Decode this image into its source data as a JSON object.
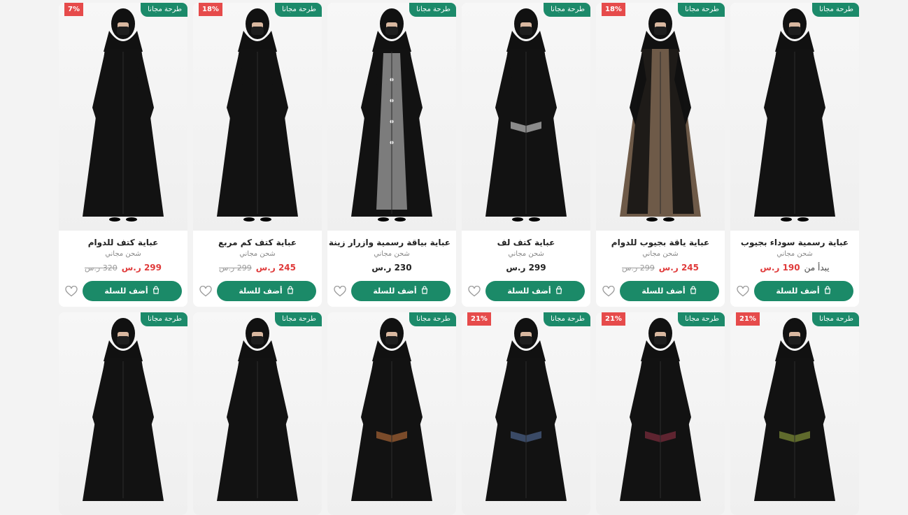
{
  "labels": {
    "free_badge": "طرحة مجانا",
    "shipping": "شحن مجاني",
    "add_to_cart": "أضف للسلة",
    "currency": "ر.س",
    "starts_from": "يبدأ من"
  },
  "colors": {
    "primary_green": "#1b8a68",
    "discount_red": "#e64b4b",
    "price_red": "#e03b3b"
  },
  "products": [
    {
      "title": "عباية رسمية سوداء بجيوب",
      "discount": "",
      "price": "190 ر.س",
      "old_price": "",
      "starts_from": true,
      "dress": "black",
      "trim": "none"
    },
    {
      "title": "عباية ياقة بجيوب للدوام",
      "discount": "18%",
      "price": "245 ر.س",
      "old_price": "299 ر.س",
      "starts_from": false,
      "dress": "brown",
      "trim": "none"
    },
    {
      "title": "عباية كتف لف",
      "discount": "",
      "price": "299 ر.س",
      "old_price": "",
      "starts_from": false,
      "dress": "black",
      "trim": "gray"
    },
    {
      "title": "عباية بياقة رسمية وازرار زينة",
      "discount": "",
      "price": "230 ر.س",
      "old_price": "",
      "starts_from": false,
      "dress": "gray",
      "trim": "none"
    },
    {
      "title": "عباية كتف كم مربع",
      "discount": "18%",
      "price": "245 ر.س",
      "old_price": "299 ر.س",
      "starts_from": false,
      "dress": "black",
      "trim": "none"
    },
    {
      "title": "عباية كتف للدوام",
      "discount": "7%",
      "price": "299 ر.س",
      "old_price": "320 ر.س",
      "starts_from": false,
      "dress": "black",
      "trim": "none"
    }
  ],
  "products_row2": [
    {
      "discount": "21%",
      "trim": "olive"
    },
    {
      "discount": "21%",
      "trim": "maroon"
    },
    {
      "discount": "21%",
      "trim": "navy"
    },
    {
      "discount": "",
      "trim": "brown"
    },
    {
      "discount": "",
      "trim": "none"
    },
    {
      "discount": "",
      "trim": "none"
    }
  ]
}
